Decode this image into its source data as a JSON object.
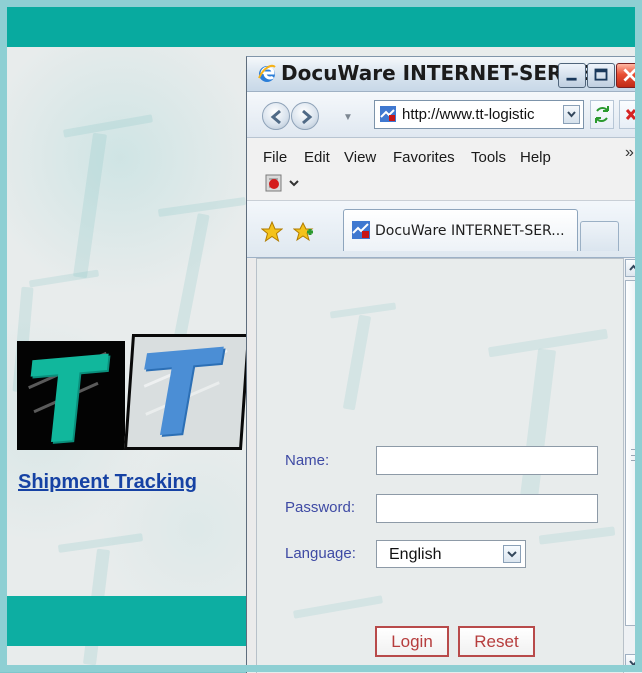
{
  "website": {
    "shipment_tracking": "Shipment Tracking"
  },
  "browser": {
    "title": "DocuWare INTERNET-SERVE...",
    "address": "http://www.tt-logistic",
    "menu": {
      "file": "File",
      "edit": "Edit",
      "view": "View",
      "favorites": "Favorites",
      "tools": "Tools",
      "help": "Help",
      "overflow": "»"
    },
    "tab": {
      "label": "DocuWare INTERNET-SER..."
    }
  },
  "login_form": {
    "name_label": "Name:",
    "password_label": "Password:",
    "language_label": "Language:",
    "language_value": "English",
    "login_button": "Login",
    "reset_button": "Reset"
  },
  "colors": {
    "accent_teal": "#08aa9f",
    "link_blue": "#1642a4",
    "form_label_blue": "#3e4aa4",
    "button_red": "#b63d3d"
  },
  "icons": {
    "browser": "internet-explorer-icon",
    "back": "back-arrow-icon",
    "forward": "forward-arrow-icon",
    "site": "site-favicon-icon",
    "refresh": "refresh-icon",
    "stop": "stop-icon",
    "pdf": "pdf-icon",
    "favorites": "favorites-star-icon",
    "add_favorites": "add-favorite-icon",
    "dropdown": "chevron-down-icon"
  }
}
